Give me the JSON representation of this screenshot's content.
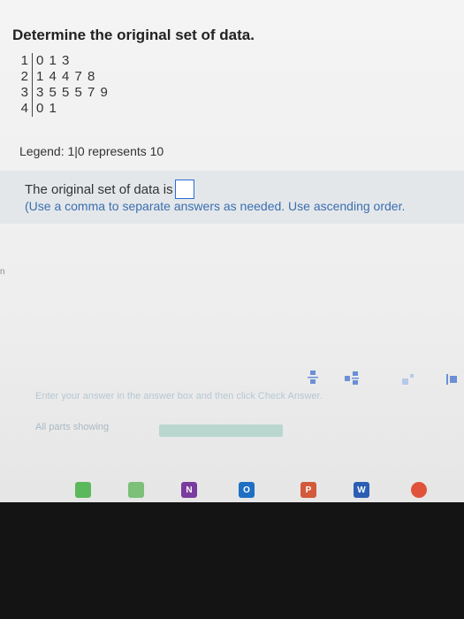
{
  "problem": {
    "title": "Determine the original set of data.",
    "stem_leaf": [
      {
        "stem": "1",
        "leaves": "0 1 3"
      },
      {
        "stem": "2",
        "leaves": "1 4 4 7 8"
      },
      {
        "stem": "3",
        "leaves": "3 5 5 5 7 9"
      },
      {
        "stem": "4",
        "leaves": "0 1"
      }
    ],
    "legend": "Legend: 1|0 represents 10"
  },
  "answer": {
    "prompt": "The original set of data is",
    "instructions": "(Use a comma to separate answers as needed. Use ascending order."
  },
  "side_mark": "n",
  "footer": {
    "hint": "Enter your answer in the answer box and then click Check Answer.",
    "parts": "All parts showing"
  },
  "taskbar": [
    {
      "name": "calendar-app-icon",
      "label": "",
      "color": "#5cb85c"
    },
    {
      "name": "star-app-icon",
      "label": "",
      "color": "#7cc07a"
    },
    {
      "name": "onenote-app-icon",
      "label": "N",
      "color": "#7a3c9e"
    },
    {
      "name": "outlook-app-icon",
      "label": "O",
      "color": "#1f6fc4"
    },
    {
      "name": "powerpoint-app-icon",
      "label": "P",
      "color": "#d2593a"
    },
    {
      "name": "word-app-icon",
      "label": "W",
      "color": "#2b5fb3"
    },
    {
      "name": "chrome-app-icon",
      "label": "",
      "color": "#e0533a"
    }
  ]
}
